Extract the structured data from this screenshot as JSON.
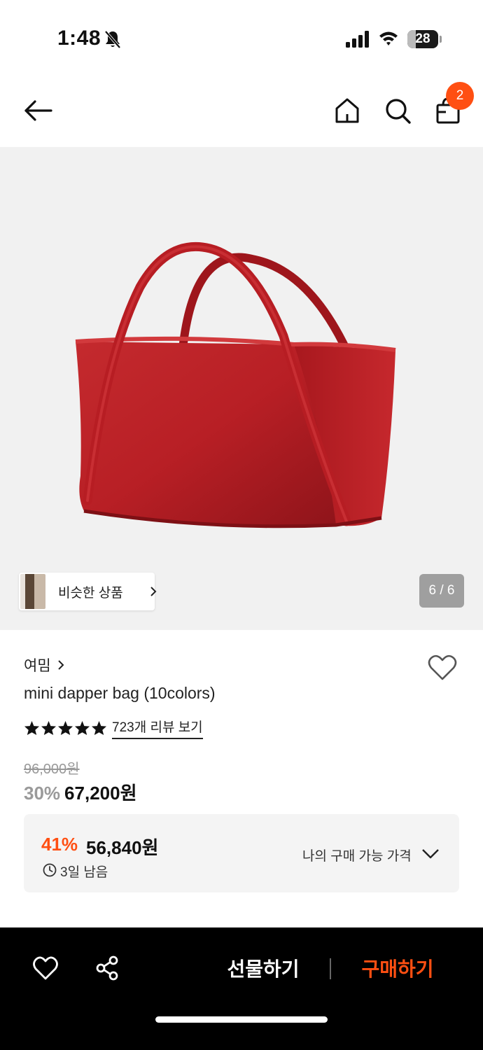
{
  "status_bar": {
    "time": "1:48",
    "battery": "28",
    "icons": [
      "bell-off-icon",
      "signal-icon",
      "wifi-icon",
      "battery-icon"
    ]
  },
  "header": {
    "icons": [
      "back-arrow-icon",
      "home-icon",
      "search-icon",
      "shopping-bag-icon"
    ],
    "cart_count": "2",
    "badge_color": "#ff4f12"
  },
  "gallery": {
    "similar_label": "비슷한 상품",
    "page_counter": "6 / 6"
  },
  "product": {
    "brand": "여밈",
    "title": "mini dapper bag (10colors)",
    "rating_stars": 5,
    "review_link": "723개 리뷰 보기",
    "original_price": "96,000원",
    "discount_rate": "30%",
    "sale_price": "67,200원"
  },
  "coupon": {
    "discount_rate": "41%",
    "price": "56,840원",
    "remaining": "3일 남음",
    "my_price_label": "나의 구매 가능 가격",
    "accent_color": "#ff4f12"
  },
  "bottom_bar": {
    "gift_label": "선물하기",
    "buy_label": "구매하기",
    "icons": [
      "heart-icon",
      "share-icon"
    ]
  }
}
